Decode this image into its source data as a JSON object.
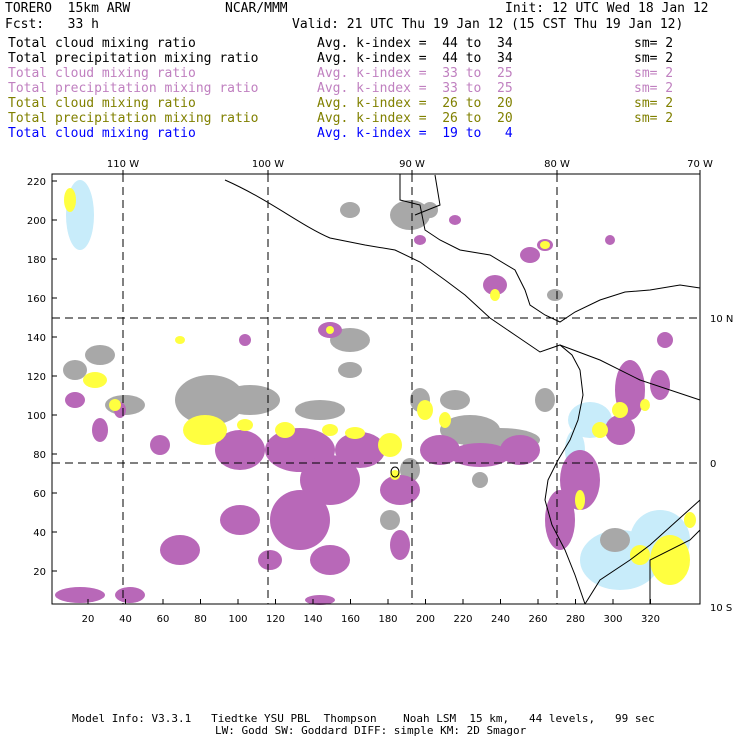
{
  "header": {
    "model": "TORERO  15km ARW",
    "org": "NCAR/MMM",
    "init": "Init: 12 UTC Wed 18 Jan 12",
    "fcst": "Fcst:   33 h",
    "valid": "Valid: 21 UTC Thu 19 Jan 12 (15 CST Thu 19 Jan 12)"
  },
  "legend": [
    {
      "field": "Total cloud mixing ratio",
      "range": "Avg. k-index =  44 to  34",
      "sm": "sm= 2",
      "color": "#000000"
    },
    {
      "field": "Total precipitation mixing ratio",
      "range": "Avg. k-index =  44 to  34",
      "sm": "sm= 2",
      "color": "#000000"
    },
    {
      "field": "Total cloud mixing ratio",
      "range": "Avg. k-index =  33 to  25",
      "sm": "sm= 2",
      "color": "#c080c0"
    },
    {
      "field": "Total precipitation mixing ratio",
      "range": "Avg. k-index =  33 to  25",
      "sm": "sm= 2",
      "color": "#c080c0"
    },
    {
      "field": "Total cloud mixing ratio",
      "range": "Avg. k-index =  26 to  20",
      "sm": "sm= 2",
      "color": "#808000"
    },
    {
      "field": "Total precipitation mixing ratio",
      "range": "Avg. k-index =  26 to  20",
      "sm": "sm= 2",
      "color": "#808000"
    },
    {
      "field": "Total cloud mixing ratio",
      "range": "Avg. k-index =  19 to   4",
      "sm": "",
      "color": "#0000ff"
    }
  ],
  "axes": {
    "top": [
      "110 W",
      "100 W",
      "90 W",
      "80 W",
      "70 W"
    ],
    "right": [
      "10 N",
      "0",
      "10 S"
    ],
    "left": [
      "220",
      "200",
      "180",
      "160",
      "140",
      "120",
      "100",
      "80",
      "60",
      "40",
      "20"
    ],
    "bottom": [
      "20",
      "40",
      "60",
      "80",
      "100",
      "120",
      "140",
      "160",
      "180",
      "200",
      "220",
      "240",
      "260",
      "280",
      "300",
      "320"
    ]
  },
  "colors": {
    "gray": "#a8a8a8",
    "purple": "#b868b8",
    "yellow": "#ffff40",
    "lightblue": "#c8ecfa"
  },
  "footer": {
    "line1": "Model Info: V3.3.1   Tiedtke YSU PBL  Thompson    Noah LSM  15 km,   44 levels,   99 sec",
    "line2": "LW: Godd SW: Goddard DIFF: simple KM: 2D Smagor"
  }
}
